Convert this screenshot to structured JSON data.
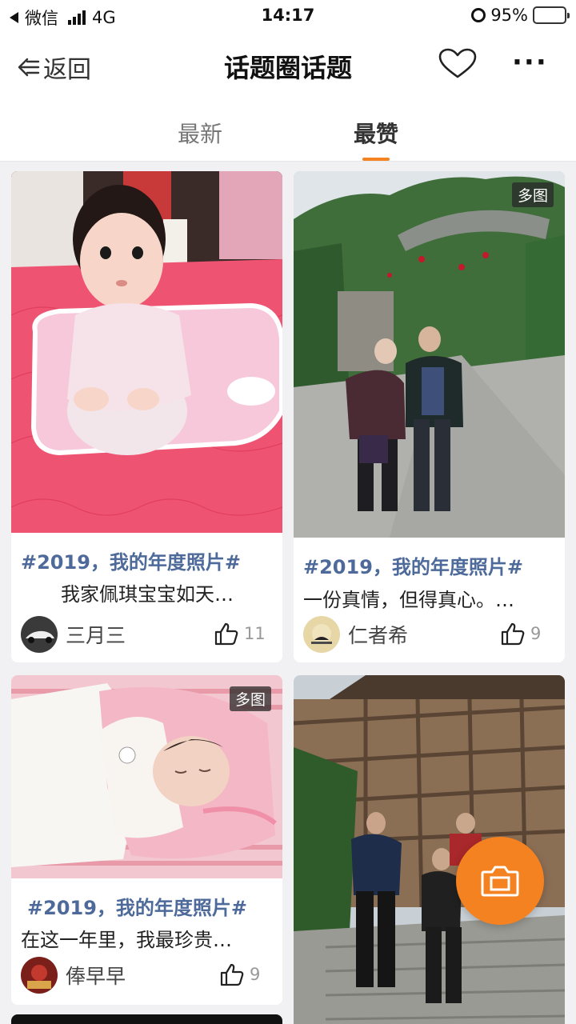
{
  "status_bar": {
    "carrier": "微信",
    "network": "4G",
    "time": "14:17",
    "battery": "95%"
  },
  "nav": {
    "back_label": "返回",
    "title": "话题圈话题"
  },
  "tabs": [
    {
      "label": "最新",
      "active": false
    },
    {
      "label": "最赞",
      "active": true
    }
  ],
  "accent_color": "#f58220",
  "topic_color": "#4d6a9a",
  "cards": [
    {
      "topic": "#2019，我的年度照片#",
      "text": "我家佩琪宝宝如天…",
      "user": "三月三",
      "likes": "11",
      "multi": ""
    },
    {
      "topic": "#2019，我的年度照片#",
      "text": "一份真情，但得真心。…",
      "user": "仁者希",
      "likes": "9",
      "multi": "多图"
    },
    {
      "topic": "#2019，我的年度照片#",
      "text": "在这一年里，我最珍贵…",
      "user": "俸早早",
      "likes": "9",
      "multi": "多图"
    }
  ],
  "icons": [
    "back-arrow-icon",
    "heart-icon",
    "more-icon",
    "thumbs-up-icon",
    "camera-icon"
  ]
}
